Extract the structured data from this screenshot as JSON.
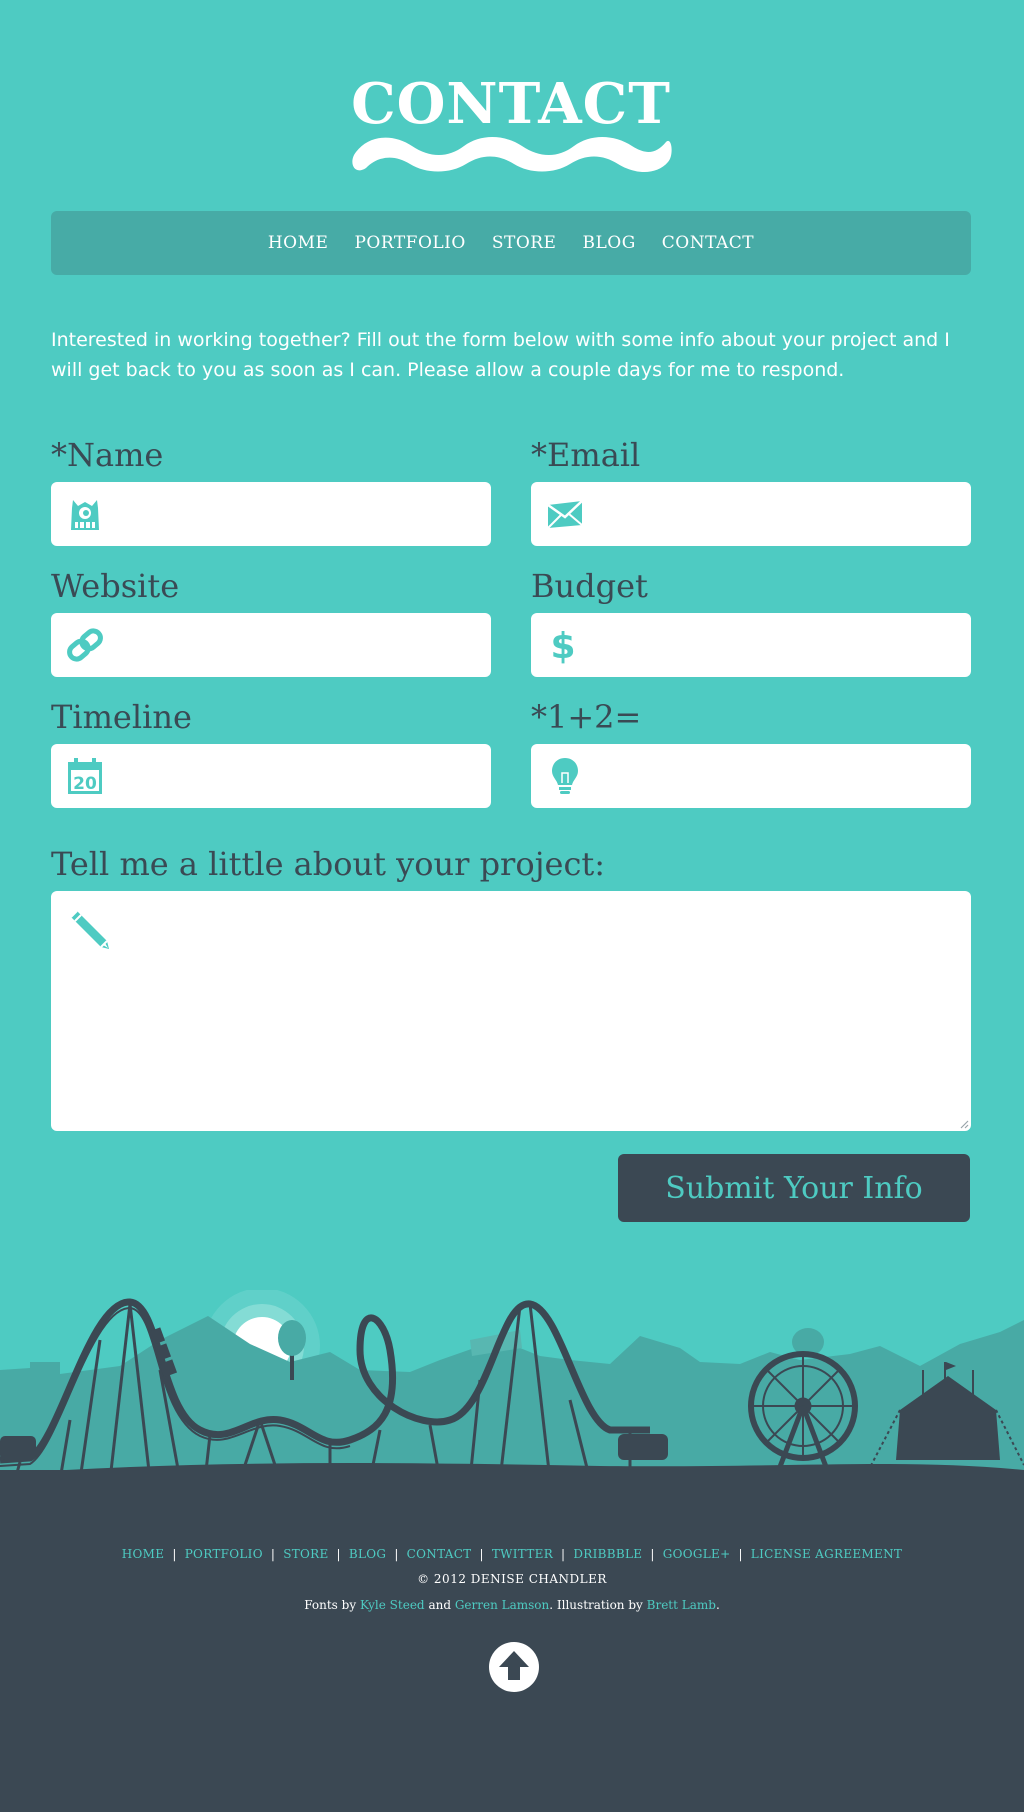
{
  "header": {
    "title": "CONTACT"
  },
  "nav": {
    "items": [
      "HOME",
      "PORTFOLIO",
      "STORE",
      "BLOG",
      "CONTACT"
    ]
  },
  "intro": "Interested in working together? Fill out the form below with some info about your project and I will get back to you as soon as I can. Please allow a couple days for me to respond.",
  "form": {
    "name_label": "*Name",
    "email_label": "*Email",
    "website_label": "Website",
    "budget_label": "Budget",
    "timeline_label": "Timeline",
    "captcha_label": "*1+2=",
    "project_label": "Tell me a little about your project:",
    "submit_label": "Submit Your Info",
    "icons": {
      "name": "monster-icon",
      "email": "envelope-icon",
      "website": "link-icon",
      "budget": "dollar-icon",
      "timeline": "calendar-icon",
      "captcha": "lightbulb-icon",
      "project": "pencil-icon"
    },
    "calendar_day": "20",
    "budget_symbol": "$"
  },
  "footer": {
    "links": [
      "HOME",
      "PORTFOLIO",
      "STORE",
      "BLOG",
      "CONTACT",
      "TWITTER",
      "DRIBBBLE",
      "GOOGLE+",
      "LICENSE AGREEMENT"
    ],
    "copyright": "© 2012 DENISE CHANDLER",
    "credits": {
      "prefix": "Fonts by",
      "font_author_1": "Kyle Steed",
      "and": "and",
      "font_author_2": "Gerren Lamson",
      "illustration_prefix": ". Illustration by",
      "illustrator": "Brett Lamb",
      "suffix": "."
    },
    "top_icon": "up-arrow-icon"
  },
  "colors": {
    "background": "#4ecbc2",
    "nav_bg": "#47aba6",
    "dark": "#3b4853",
    "label": "#3a4a54",
    "white": "#ffffff"
  }
}
